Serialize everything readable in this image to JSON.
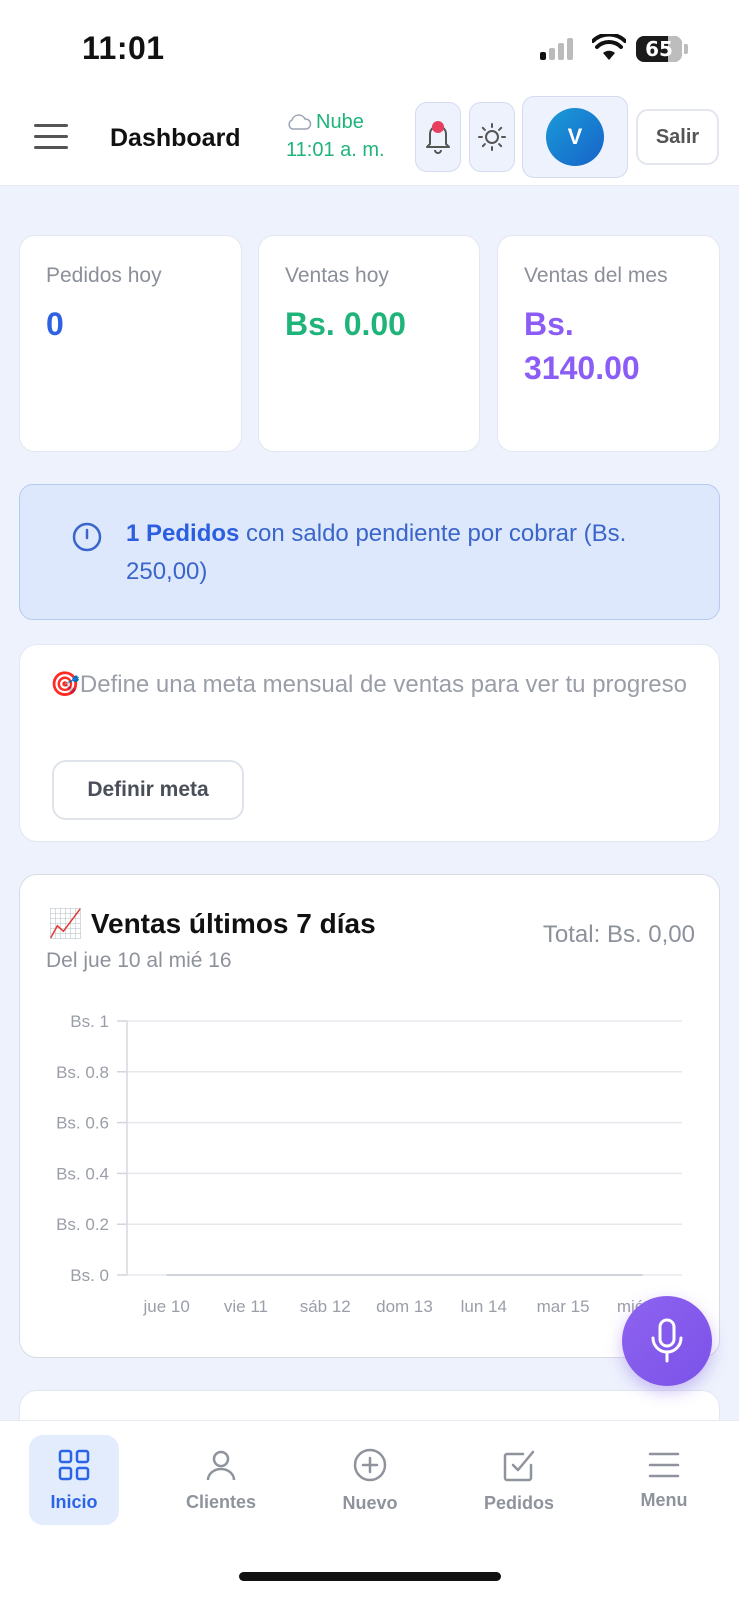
{
  "status_bar": {
    "time": "11:01",
    "battery": "65",
    "icons": [
      "signal-icon",
      "wifi-icon",
      "battery-icon"
    ]
  },
  "header": {
    "title": "Dashboard",
    "sync_status": "Nube",
    "sync_time": "11:01 a. m.",
    "avatar_initial": "V",
    "logout_label": "Salir",
    "icons": [
      "menu-icon",
      "cloud-icon",
      "bell-icon",
      "sun-icon"
    ]
  },
  "stats": [
    {
      "label": "Pedidos hoy",
      "value": "0",
      "color": "#2f62e3"
    },
    {
      "label": "Ventas hoy",
      "value": "Bs. 0.00",
      "color": "#1fb47a"
    },
    {
      "label": "Ventas del mes",
      "value": "Bs. 3140.00",
      "color": "#8b5cf6"
    }
  ],
  "alert": {
    "count_text": "1 Pedidos",
    "message": " con saldo pendiente por cobrar (Bs. 250,00)",
    "icon": "clock-icon"
  },
  "goal": {
    "emoji": "🎯",
    "text": "Define una meta mensual de ventas para ver tu progreso",
    "button_label": "Definir meta"
  },
  "sales_chart": {
    "emoji": "📈",
    "title": "Ventas últimos 7 días",
    "subtitle": "Del jue 10 al mié 16",
    "total": "Total: Bs. 0,00"
  },
  "chart_data": {
    "type": "line",
    "categories": [
      "jue 10",
      "vie 11",
      "sáb 12",
      "dom 13",
      "lun 14",
      "mar 15",
      "mié 16"
    ],
    "series": [
      {
        "values": [
          0,
          0,
          0,
          0,
          0,
          0,
          0
        ]
      }
    ],
    "y_ticks": [
      "Bs. 0",
      "Bs. 0.2",
      "Bs. 0.4",
      "Bs. 0.6",
      "Bs. 0.8",
      "Bs. 1"
    ],
    "ylim": [
      0,
      1
    ],
    "grid": true,
    "title": "Ventas últimos 7 días"
  },
  "bottom_nav": [
    {
      "label": "Inicio",
      "icon": "grid-icon",
      "active": true
    },
    {
      "label": "Clientes",
      "icon": "user-icon",
      "active": false
    },
    {
      "label": "Nuevo",
      "icon": "plus-circle-icon",
      "active": false
    },
    {
      "label": "Pedidos",
      "icon": "checkbox-icon",
      "active": false
    },
    {
      "label": "Menu",
      "icon": "hamburger-icon",
      "active": false
    }
  ],
  "colors": {
    "accent_blue": "#2b64e6",
    "accent_green": "#1fb47a",
    "accent_purple": "#8b5cf6",
    "background": "#eef2fc"
  }
}
